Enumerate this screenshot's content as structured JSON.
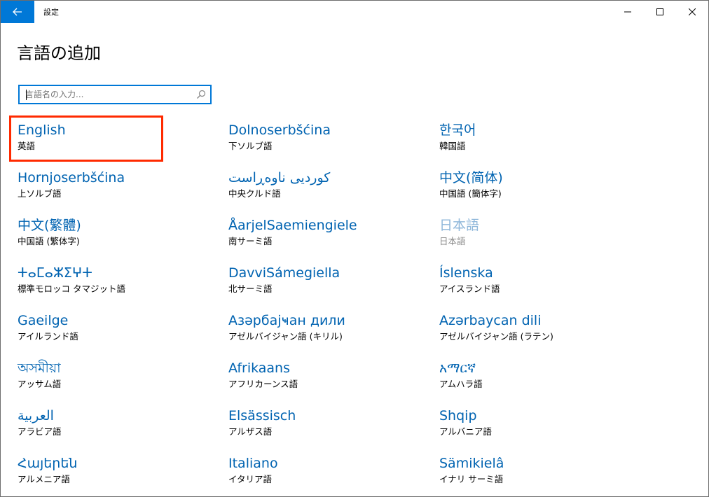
{
  "window": {
    "title": "設定",
    "back_icon": "arrow-left-icon",
    "minimize_icon": "minimize-icon",
    "maximize_icon": "maximize-icon",
    "close_icon": "close-icon"
  },
  "page": {
    "title": "言語の追加"
  },
  "search": {
    "placeholder": "言語名の入力...",
    "value": "",
    "icon": "search-icon"
  },
  "colors": {
    "accent": "#0078d7",
    "link": "#0063b1",
    "highlight": "#ff2a00"
  },
  "languages": [
    {
      "native": "English",
      "local": "英語",
      "highlighted": true
    },
    {
      "native": "Dolnoserbšćina",
      "local": "下ソルブ語"
    },
    {
      "native": "한국어",
      "local": "韓国語"
    },
    {
      "native": "Hornjoserbšćina",
      "local": "上ソルブ語"
    },
    {
      "native": "کوردیی ناوەڕاست",
      "local": "中央クルド語"
    },
    {
      "native": "中文(简体)",
      "local": "中国語 (簡体字)"
    },
    {
      "native": "中文(繁體)",
      "local": "中国語 (繁体字)"
    },
    {
      "native": "ÅarjelSaemiengiele",
      "local": "南サーミ語"
    },
    {
      "native": "日本語",
      "local": "日本語",
      "disabled": true
    },
    {
      "native": "ⵜⴰⵎⴰⵣⵉⵖⵜ",
      "local": "標準モロッコ タマジット語"
    },
    {
      "native": "DavviSámegiella",
      "local": "北サーミ語"
    },
    {
      "native": "Íslenska",
      "local": "アイスランド語"
    },
    {
      "native": "Gaeilge",
      "local": "アイルランド語"
    },
    {
      "native": "Азәрбајҹан дили",
      "local": "アゼルバイジャン語 (キリル)"
    },
    {
      "native": "Azərbaycan dili",
      "local": "アゼルバイジャン語 (ラテン)"
    },
    {
      "native": "অসমীয়া",
      "local": "アッサム語"
    },
    {
      "native": "Afrikaans",
      "local": "アフリカーンス語"
    },
    {
      "native": "አማርኛ",
      "local": "アムハラ語"
    },
    {
      "native": "العربية",
      "local": "アラビア語"
    },
    {
      "native": "Elsässisch",
      "local": "アルザス語"
    },
    {
      "native": "Shqip",
      "local": "アルバニア語"
    },
    {
      "native": "Հայերեն",
      "local": "アルメニア語"
    },
    {
      "native": "Italiano",
      "local": "イタリア語"
    },
    {
      "native": "Sämikielâ",
      "local": "イナリ サーミ語"
    }
  ]
}
